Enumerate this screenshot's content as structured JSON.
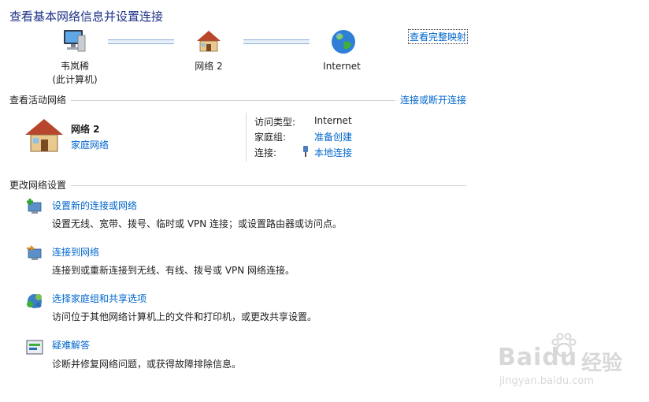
{
  "page_title": "查看基本网络信息并设置连接",
  "map": {
    "computer_name": "韦岚稀",
    "computer_sub": "(此计算机)",
    "network_name": "网络  2",
    "internet_label": "Internet",
    "full_map_link": "查看完整映射"
  },
  "active": {
    "section_title": "查看活动网络",
    "connect_link": "连接或断开连接",
    "network_name": "网络  2",
    "network_type": "家庭网络",
    "access_label": "访问类型:",
    "access_value": "Internet",
    "homegroup_label": "家庭组:",
    "homegroup_value": "准备创建",
    "connection_label": "连接:",
    "connection_value": "本地连接"
  },
  "settings": {
    "section_title": "更改网络设置",
    "tasks": [
      {
        "title": "设置新的连接或网络",
        "desc": "设置无线、宽带、拨号、临时或 VPN 连接；或设置路由器或访问点。"
      },
      {
        "title": "连接到网络",
        "desc": "连接到或重新连接到无线、有线、拨号或 VPN 网络连接。"
      },
      {
        "title": "选择家庭组和共享选项",
        "desc": "访问位于其他网络计算机上的文件和打印机，或更改共享设置。"
      },
      {
        "title": "疑难解答",
        "desc": "诊断并修复网络问题，或获得故障排除信息。"
      }
    ]
  },
  "watermark": {
    "brand": "Baidu",
    "brand_cn": "经验",
    "url": "jingyan.baidu.com"
  }
}
